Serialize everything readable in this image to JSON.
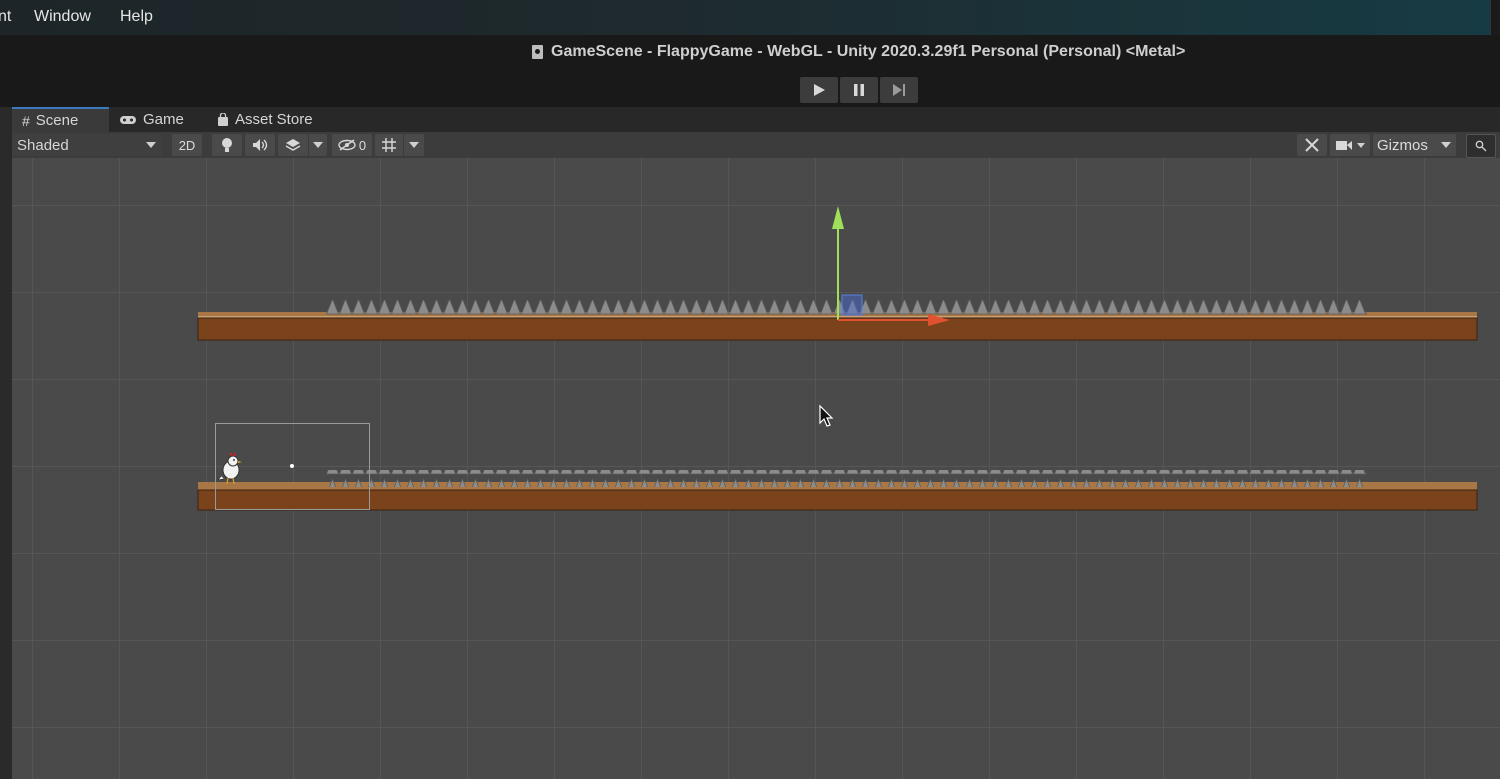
{
  "menubar": {
    "items": [
      "nt",
      "Window",
      "Help"
    ]
  },
  "window": {
    "title": "GameScene - FlappyGame - WebGL - Unity 2020.3.29f1 Personal (Personal) <Metal>"
  },
  "playbar": {
    "play_icon": "play-icon",
    "pause_icon": "pause-icon",
    "step_icon": "step-icon"
  },
  "tabs": [
    {
      "label": "Scene",
      "icon": "grid-icon",
      "active": true
    },
    {
      "label": "Game",
      "icon": "gamepad-icon",
      "active": false
    },
    {
      "label": "Asset Store",
      "icon": "bag-icon",
      "active": false
    }
  ],
  "scene_toolbar": {
    "shading_mode": "Shaded",
    "mode_2d_label": "2D",
    "hidden_count": "0",
    "gizmos_label": "Gizmos"
  },
  "colors": {
    "ground_top": "#a97646",
    "ground_body": "#7b431c",
    "spike": "#8c8c8c",
    "gizmo_y": "#9fe05a",
    "gizmo_x": "#e0522f"
  }
}
